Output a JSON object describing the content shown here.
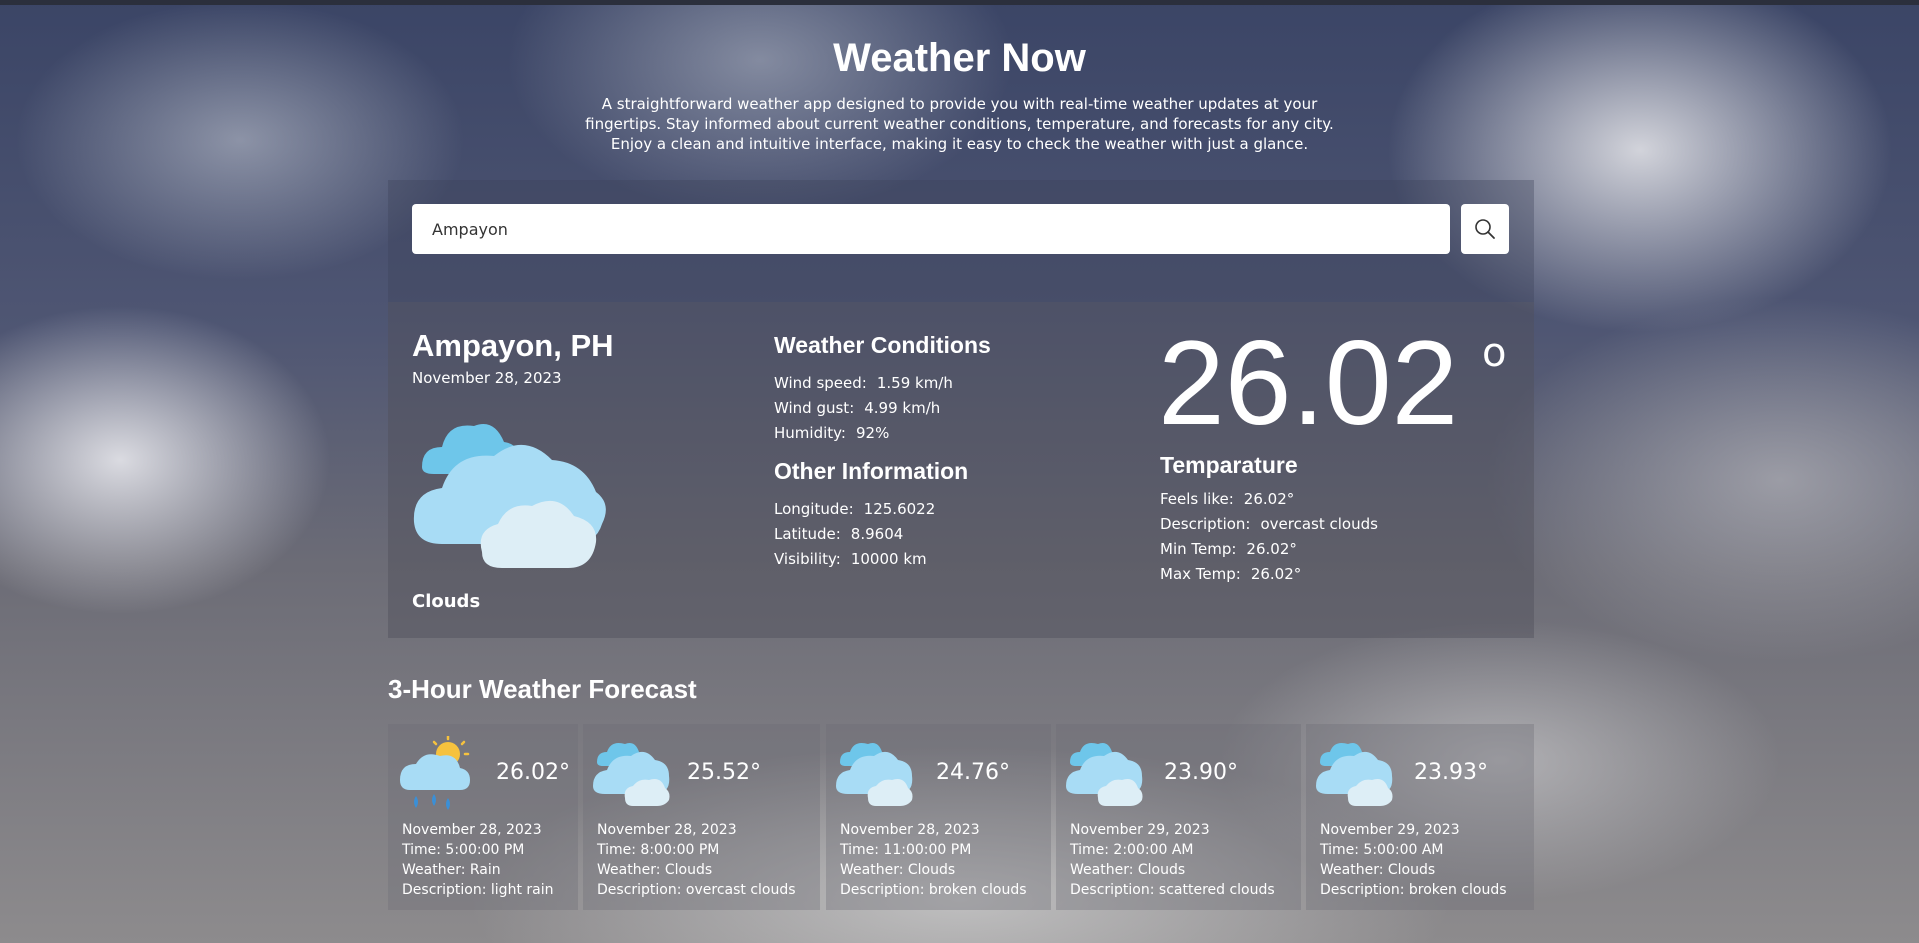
{
  "header": {
    "title": "Weather Now",
    "subtitle": "A straightforward weather app designed to provide you with real-time weather updates at your fingertips. Stay informed about current weather conditions, temperature, and forecasts for any city. Enjoy a clean and intuitive interface, making it easy to check the weather with just a glance."
  },
  "search": {
    "value": "Ampayon",
    "button_icon": "search-icon"
  },
  "current": {
    "city": "Ampayon, PH",
    "date": "November 28, 2023",
    "icon": "cloud-icon",
    "condition": "Clouds",
    "conditions_heading": "Weather Conditions",
    "wind_speed_label": "Wind speed:",
    "wind_speed": "1.59 km/h",
    "wind_gust_label": "Wind gust:",
    "wind_gust": "4.99 km/h",
    "humidity_label": "Humidity:",
    "humidity": "92%",
    "other_heading": "Other Information",
    "longitude_label": "Longitude:",
    "longitude": "125.6022",
    "latitude_label": "Latitude:",
    "latitude": "8.9604",
    "visibility_label": "Visibility:",
    "visibility": "10000 km",
    "temperature": "26.02",
    "degree_symbol": "o",
    "temp_heading": "Temparature",
    "feels_like_label": "Feels like:",
    "feels_like": "26.02°",
    "description_label": "Description:",
    "description": "overcast clouds",
    "min_temp_label": "Min Temp:",
    "min_temp": "26.02°",
    "max_temp_label": "Max Temp:",
    "max_temp": "26.02°"
  },
  "forecast": {
    "title": "3-Hour Weather Forecast",
    "items": [
      {
        "icon": "rain-cloud-sun-icon",
        "temp": "26.02°",
        "date": "November 28, 2023",
        "time": "Time: 5:00:00 PM",
        "weather": "Weather: Rain",
        "description": "Description: light rain"
      },
      {
        "icon": "cloud-icon",
        "temp": "25.52°",
        "date": "November 28, 2023",
        "time": "Time: 8:00:00 PM",
        "weather": "Weather: Clouds",
        "description": "Description: overcast clouds"
      },
      {
        "icon": "cloud-icon",
        "temp": "24.76°",
        "date": "November 28, 2023",
        "time": "Time: 11:00:00 PM",
        "weather": "Weather: Clouds",
        "description": "Description: broken clouds"
      },
      {
        "icon": "cloud-icon",
        "temp": "23.90°",
        "date": "November 29, 2023",
        "time": "Time: 2:00:00 AM",
        "weather": "Weather: Clouds",
        "description": "Description: scattered clouds"
      },
      {
        "icon": "cloud-icon",
        "temp": "23.93°",
        "date": "November 29, 2023",
        "time": "Time: 5:00:00 AM",
        "weather": "Weather: Clouds",
        "description": "Description: broken clouds"
      }
    ]
  }
}
